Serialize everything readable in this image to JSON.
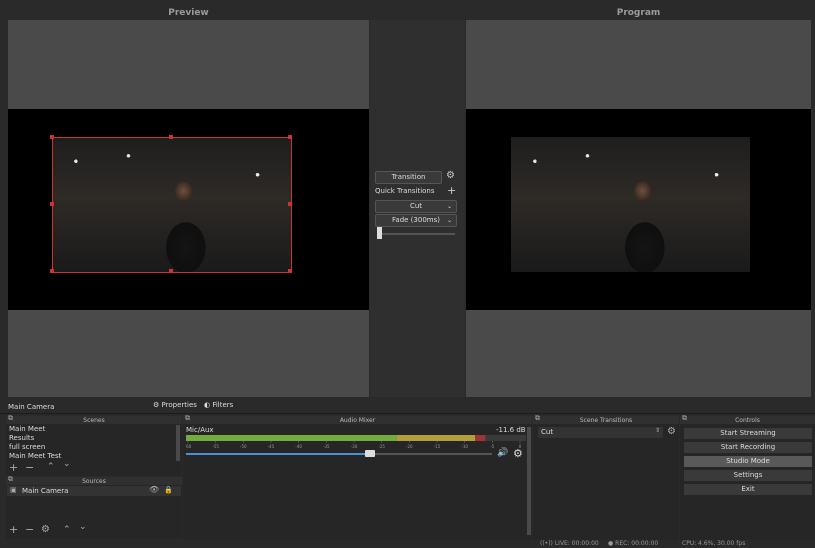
{
  "preview": {
    "title": "Preview"
  },
  "program": {
    "title": "Program"
  },
  "transition_panel": {
    "transition_button": "Transition",
    "quick_transitions_label": "Quick Transitions",
    "cut_option": "Cut",
    "fade_option": "Fade (300ms)"
  },
  "source_bar": {
    "selected_source": "Main Camera",
    "properties_label": "Properties",
    "filters_label": "Filters"
  },
  "scenes": {
    "title": "Scenes",
    "items": [
      "Main Meet",
      "Results",
      "full screen",
      "Main Meet Test"
    ]
  },
  "sources": {
    "title": "Sources",
    "items": [
      "Main Camera"
    ]
  },
  "audio_mixer": {
    "title": "Audio Mixer",
    "channel_name": "Mic/Aux",
    "level": "-11.6 dB",
    "volume_fraction": 0.6,
    "meter_fraction": 0.88,
    "ticks": [
      "-60",
      "-55",
      "-50",
      "-45",
      "-40",
      "-35",
      "-30",
      "-25",
      "-20",
      "-15",
      "-10",
      "-5",
      "0"
    ]
  },
  "scene_transitions": {
    "title": "Scene Transitions",
    "selected": "Cut"
  },
  "controls": {
    "title": "Controls",
    "start_streaming": "Start Streaming",
    "start_recording": "Start Recording",
    "studio_mode": "Studio Mode",
    "settings": "Settings",
    "exit": "Exit"
  },
  "status_bar": {
    "live": "LIVE: 00:00:00",
    "rec": "REC: 00:00:00",
    "cpu": "CPU: 4.6%, 30.00 fps"
  },
  "icons": [
    "gear-icon",
    "plus-icon",
    "minus-icon",
    "up-arrow-icon",
    "down-arrow-icon",
    "eye-icon",
    "lock-icon",
    "speaker-icon",
    "camera-icon",
    "dock-float-icon"
  ],
  "colors": {
    "selection_red": "#cc3333",
    "meter_green": "#7fbf3f",
    "meter_yellow": "#c8b23a",
    "meter_red": "#b03535",
    "volume_blue": "#4a90d9"
  }
}
